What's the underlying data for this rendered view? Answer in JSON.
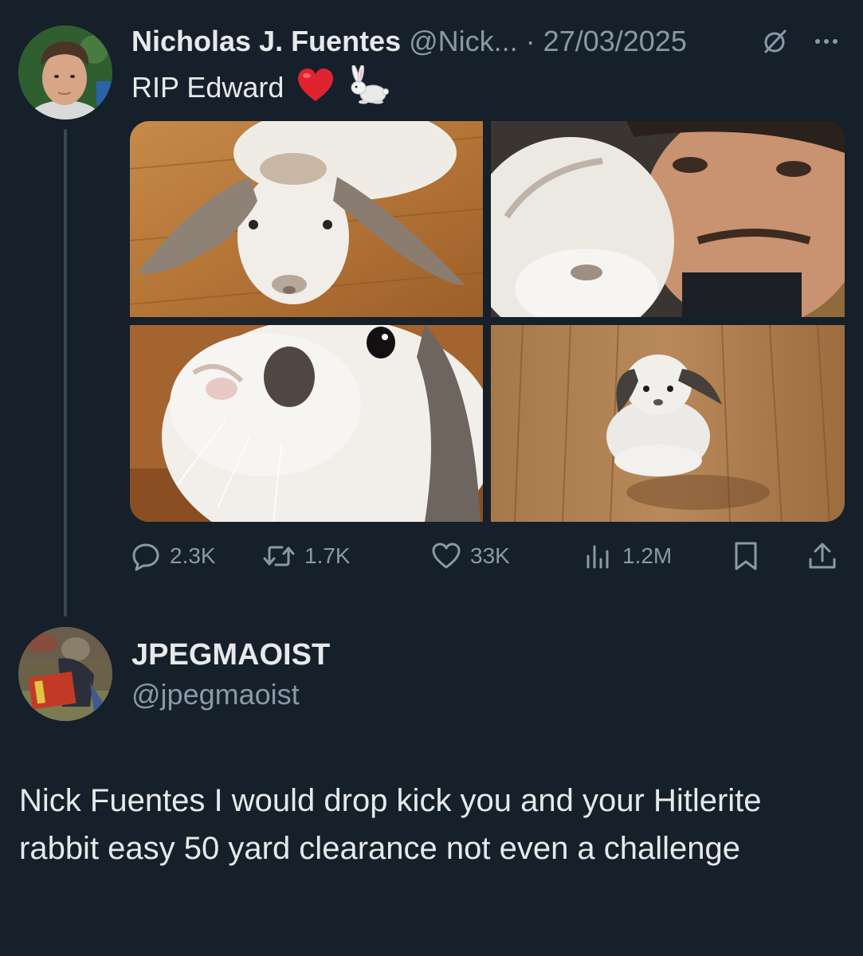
{
  "tweet": {
    "author": {
      "display_name": "Nicholas J. Fuentes",
      "handle": "@Nick...",
      "avatar_icon": "profile-photo"
    },
    "separator": " · ",
    "date": "27/03/2025",
    "text": "RIP Edward",
    "emojis": [
      "red-heart",
      "rabbit"
    ],
    "media": [
      {
        "icon": "photo-lop-rabbit-closeup"
      },
      {
        "icon": "photo-rabbit-with-man"
      },
      {
        "icon": "photo-rabbit-nose-closeup"
      },
      {
        "icon": "photo-rabbit-on-wood-floor"
      }
    ],
    "actions": {
      "replies": "2.3K",
      "retweets": "1.7K",
      "likes": "33K",
      "views": "1.2M"
    }
  },
  "reply": {
    "author": {
      "display_name": "JPEGMAOIST",
      "handle": "@jpegmaoist",
      "avatar_icon": "profile-photo"
    },
    "text": "Nick Fuentes I would drop kick you and your Hitlerite rabbit easy 50 yard clearance not even a challenge"
  },
  "colors": {
    "background": "#15202b",
    "text_primary": "#e7e9ea",
    "text_secondary": "#8b98a5",
    "thread_line": "#3a4653"
  }
}
